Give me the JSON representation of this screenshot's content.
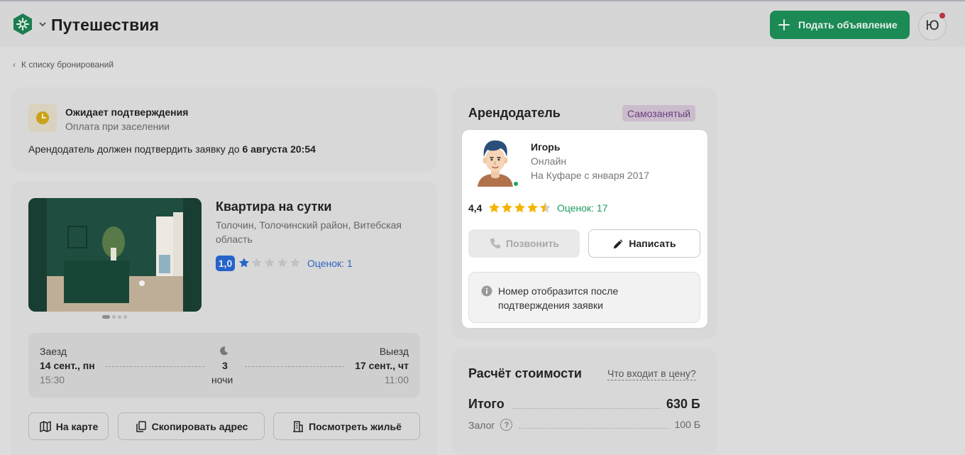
{
  "header": {
    "title": "Путешествия",
    "post_button": "Подать объявление",
    "avatar_letter": "Ю"
  },
  "breadcrumb": {
    "back_label": "К списку бронирований"
  },
  "status": {
    "title": "Ожидает подтверждения",
    "subtitle": "Оплата при заселении",
    "note_prefix": "Арендодатель должен подтвердить заявку до ",
    "deadline": "6 августа 20:54"
  },
  "listing": {
    "title": "Квартира на сутки",
    "address": "Толочин, Толочинский район, Витебская область",
    "rating": "1,0",
    "rating_value": 1.0,
    "reviews": "Оценок: 1",
    "photo_count": 4,
    "photo_active": 1
  },
  "booking": {
    "checkin_label": "Заезд",
    "checkin_date": "14 сент., пн",
    "checkin_time": "15:30",
    "nights": "3",
    "nights_label": "ночи",
    "checkout_label": "Выезд",
    "checkout_date": "17 сент., чт",
    "checkout_time": "11:00"
  },
  "actions": {
    "map": "На карте",
    "copy_address": "Скопировать адрес",
    "view_home": "Посмотреть жильё"
  },
  "landlord": {
    "section_title": "Арендодатель",
    "badge": "Самозанятый",
    "name": "Игорь",
    "online_status": "Онлайн",
    "member_since": "На Куфаре с января 2017",
    "rating": "4,4",
    "rating_value": 4.4,
    "reviews": "Оценок: 17",
    "call_button": "Позвонить",
    "write_button": "Написать",
    "phone_note": "Номер отобразится после подтверждения заявки"
  },
  "price": {
    "title": "Расчёт стоимости",
    "whats_included": "Что входит в цену?",
    "total_label": "Итого",
    "total_value": "630 Ƃ",
    "deposit_label": "Залог",
    "deposit_value": "100 Ƃ"
  },
  "colors": {
    "brand_green": "#1b8a55",
    "accent_blue": "#2563c9",
    "star_gold": "#f5b400",
    "online_green": "#1fa463"
  }
}
